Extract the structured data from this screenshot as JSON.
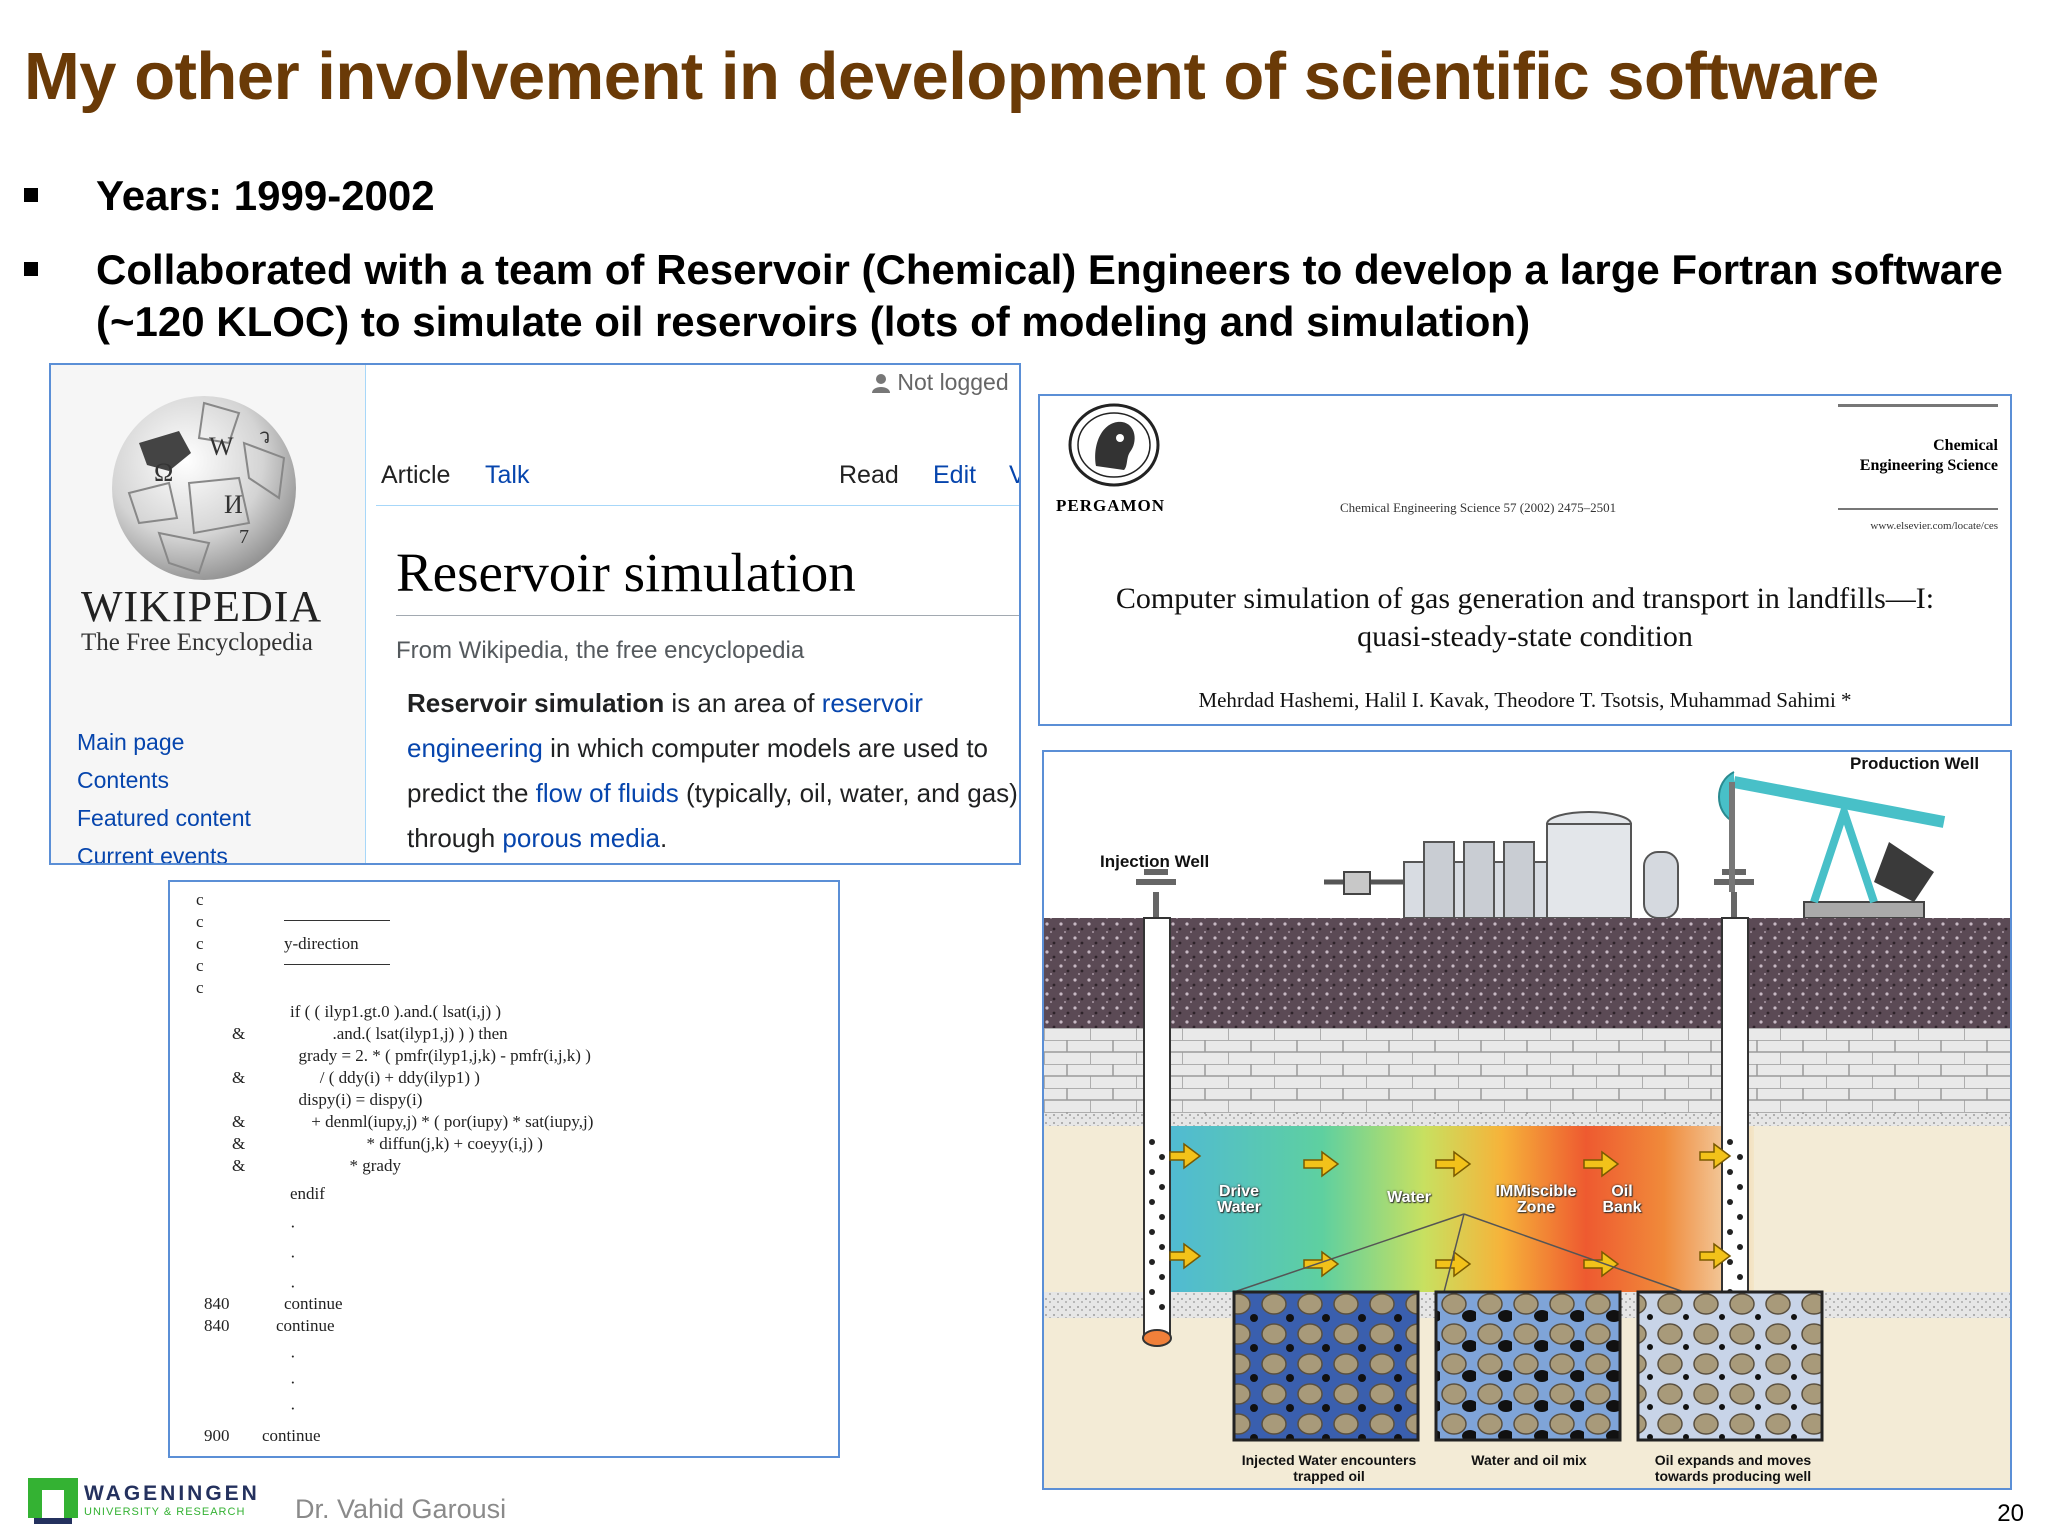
{
  "slide": {
    "title": "My other involvement in development of scientific software",
    "bullets": [
      "Years: 1999-2002",
      "Collaborated with a team of Reservoir (Chemical) Engineers to develop a large Fortran software (~120 KLOC) to simulate oil reservoirs (lots of modeling and simulation)"
    ],
    "author": "Dr. Vahid Garousi",
    "page_number": "20"
  },
  "logo": {
    "word": "WAGENINGEN",
    "sub": "UNIVERSITY & RESEARCH"
  },
  "wiki": {
    "wordmark": "WIKIPEDIA",
    "tagline": "The Free Encyclopedia",
    "not_logged": "Not logged",
    "tabs": {
      "article": "Article",
      "talk": "Talk",
      "read": "Read",
      "edit": "Edit",
      "more": "V"
    },
    "nav": [
      "Main page",
      "Contents",
      "Featured content",
      "Current events"
    ],
    "heading": "Reservoir simulation",
    "from": "From Wikipedia, the free encyclopedia",
    "para": {
      "bold": "Reservoir simulation",
      "t1": " is an area of ",
      "link1": "reservoir engineering",
      "t2": " in which computer models are used to predict the ",
      "link2": "flow of fluids",
      "t3": " (typically, oil, water, and gas) through ",
      "link3": "porous media",
      "t4": "."
    }
  },
  "paper": {
    "publisher": "PERGAMON",
    "citation": "Chemical Engineering Science 57 (2002) 2475–2501",
    "journal_line1": "Chemical",
    "journal_line2": "Engineering Science",
    "url": "www.elsevier.com/locate/ces",
    "title_line1": "Computer simulation of gas generation and transport in landfills—I:",
    "title_line2": "quasi-steady-state condition",
    "authors": "Mehrdad Hashemi, Halil I. Kavak, Theodore T. Tsotsis, Muhammad Sahimi *"
  },
  "code": {
    "lines": [
      {
        "label": "c",
        "text": ""
      },
      {
        "label": "c",
        "text": ""
      },
      {
        "label": "c",
        "text": "y-direction"
      },
      {
        "label": "c",
        "text": ""
      },
      {
        "label": "c",
        "text": ""
      },
      {
        "label": "",
        "text": "if ( ( ilyp1.gt.0 ).and.( lsat(i,j) )"
      },
      {
        "label": "&",
        "text": "          .and.( lsat(ilyp1,j) ) ) then"
      },
      {
        "label": "",
        "text": "  grady = 2. * ( pmfr(ilyp1,j,k) - pmfr(i,j,k) )"
      },
      {
        "label": "&",
        "text": "       / ( ddy(i) + ddy(ilyp1) )"
      },
      {
        "label": "",
        "text": "  dispy(i) = dispy(i)"
      },
      {
        "label": "&",
        "text": "     + denml(iupy,j) * ( por(iupy) * sat(iupy,j)"
      },
      {
        "label": "&",
        "text": "                  * diffun(j,k) + coeyy(i,j) )"
      },
      {
        "label": "&",
        "text": "              * grady"
      },
      {
        "label": "",
        "text": "endif"
      },
      {
        "label": "840",
        "text": "continue"
      },
      {
        "label": "840",
        "text": "continue"
      },
      {
        "label": "900",
        "text": "continue"
      }
    ]
  },
  "reservoir": {
    "labels": {
      "injection_well": "Injection Well",
      "production_well": "Production Well",
      "drive_water": "Drive Water",
      "water": "Water",
      "miscible_zone": "IMMiscible Zone",
      "oil_bank": "Oil Bank"
    },
    "captions": [
      "Injected Water encounters trapped oil",
      "Water and oil mix",
      "Oil expands and moves towards producing well"
    ]
  }
}
